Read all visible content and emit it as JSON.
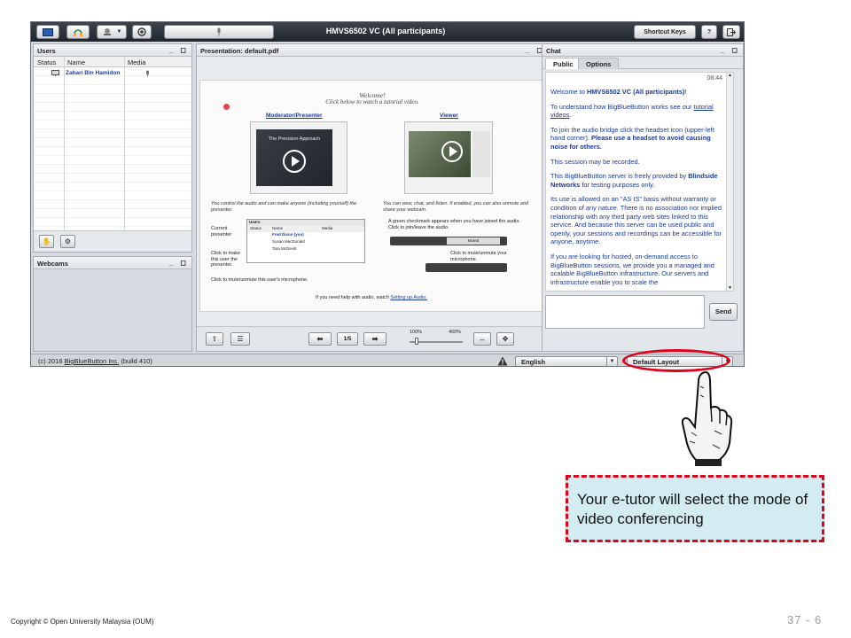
{
  "app": {
    "title": "HMVS6502 VC (All participants)",
    "shortcut_keys_label": "Shortcut Keys",
    "help_label": "?"
  },
  "users": {
    "title": "Users",
    "columns": [
      "Status",
      "Name",
      "Media"
    ],
    "rows": [
      {
        "name": "Zahari Bin Hamidon"
      }
    ]
  },
  "webcams": {
    "title": "Webcams"
  },
  "presentation": {
    "title": "Presentation: default.pdf",
    "page_label": "1/5",
    "zoom_min": "100%",
    "zoom_max": "400%",
    "slide": {
      "welcome": "Welcome!",
      "subtitle": "Click below to watch a tutorial video.",
      "moderator_heading": "Moderator/Presenter",
      "viewer_heading": "Viewer",
      "video_caption": "The Precision Approach",
      "moderator_text": "You control the audio and can make anyone (including yourself) the presenter.",
      "viewer_text": "You can view, chat, and listen.  If enabled, you can also unmute and share your webcam.",
      "mini_users_title": "Users",
      "mini_cols": [
        "Status",
        "Name",
        "Media"
      ],
      "mini_rows": [
        "Fred Dixon (you)",
        "Susan MacDonald",
        "Tara McDevitt"
      ],
      "current_presenter": "Current presenter",
      "click_make_presenter": "Click to make this user the presenter.",
      "click_mute_user": "Click to mute/unmute this user's microphone.",
      "green_check": "A green checkmark appears when you have joined the audio.  Click to join/leave the audio.",
      "muted_label": "Muted",
      "click_mute_mic": "Click to mute/unmute your microphone.",
      "help_text": "If you need help with audio, watch",
      "help_link": "Setting up Audio."
    }
  },
  "chat": {
    "title": "Chat",
    "tabs": [
      "Public",
      "Options"
    ],
    "time": "08:44",
    "messages": {
      "welcome_pre": "Welcome to ",
      "welcome_bold": "HMVS6502 VC (All participants)",
      "welcome_post": "!",
      "understand_pre": "To understand how BigBlueButton works see our ",
      "understand_link": "tutorial videos",
      "understand_post": ".",
      "audio_pre": "To join the audio bridge click the headset icon (upper-left hand corner). ",
      "audio_bold": "Please use a headset to avoid causing noise for others.",
      "recorded": "This session may be recorded.",
      "server_pre": "This BigBlueButton server is freely provided by ",
      "server_bold": "Blindside Networks",
      "server_post": " for testing purposes only.",
      "asis": "Its use is allowed on an \"AS IS\" basis without warranty or condition of any nature. There is no association nor implied relationship with any third party web sites linked to this service. And because this server can be used public and openly, your sessions and recordings can be accessible for anyone, anytime.",
      "hosted": "If you are looking for hosted, on-demand access to BigBlueButton sessions, we provide you a managed and scalable BigBlueButton infrastructure. Our servers and infrastructure enable you to scale the"
    },
    "send_label": "Send"
  },
  "status_bar": {
    "copyright_pre": "(c) 2016 ",
    "copyright_link": "BigBlueButton Inc.",
    "copyright_post": " (build 410)",
    "language": "English",
    "layout": "Default Layout"
  },
  "callout": "Your e-tutor will select the mode of  video conferencing",
  "footer": {
    "copyright": "Copyright © Open University Malaysia (OUM)",
    "page_number": "37 - 6"
  },
  "colors": {
    "annotation_red": "#e3001b",
    "callout_bg": "#d2ecf2",
    "chat_text": "#1a3a9e"
  }
}
